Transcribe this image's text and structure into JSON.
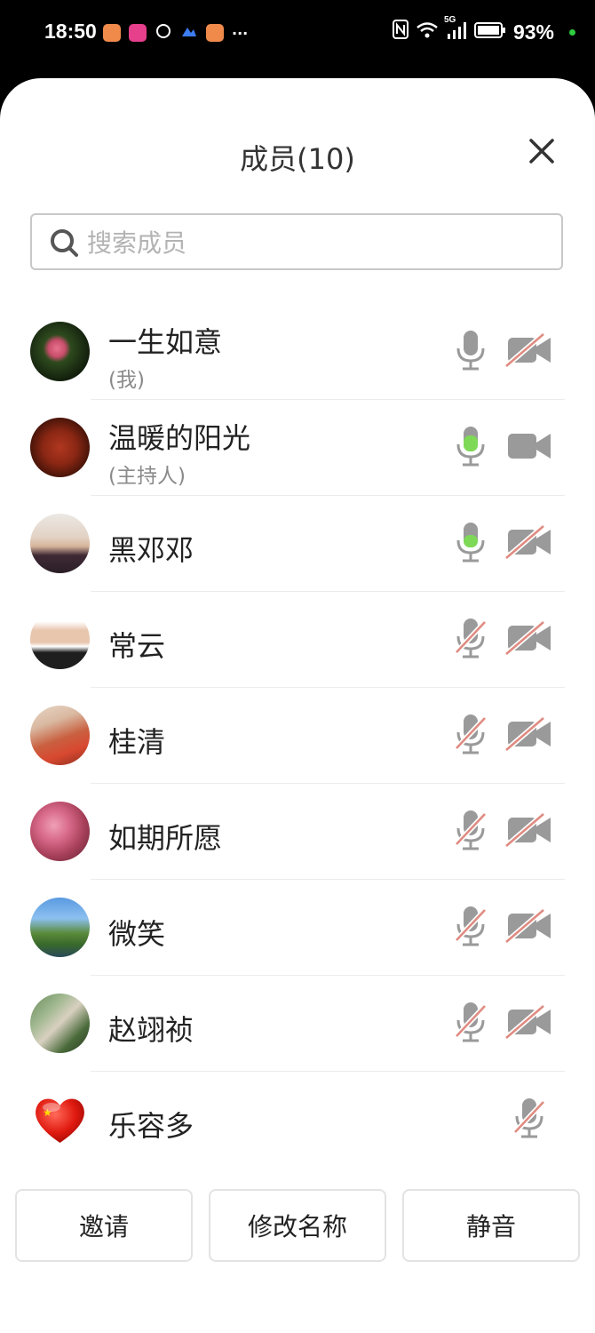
{
  "status_bar": {
    "time": "18:50",
    "more": "···",
    "network": "5G",
    "battery": "93%"
  },
  "panel": {
    "title": "成员(10)",
    "search_placeholder": "搜索成员"
  },
  "members": [
    {
      "name": "一生如意",
      "role": "(我)",
      "mic": "off",
      "camera": "off"
    },
    {
      "name": "温暖的阳光",
      "role": "(主持人)",
      "mic": "active",
      "camera": "on"
    },
    {
      "name": "黑邓邓",
      "role": "",
      "mic": "active",
      "camera": "off"
    },
    {
      "name": "常云",
      "role": "",
      "mic": "muted",
      "camera": "off"
    },
    {
      "name": "桂清",
      "role": "",
      "mic": "muted",
      "camera": "off"
    },
    {
      "name": "如期所愿",
      "role": "",
      "mic": "muted",
      "camera": "off"
    },
    {
      "name": "微笑",
      "role": "",
      "mic": "muted",
      "camera": "off"
    },
    {
      "name": "赵翊祯",
      "role": "",
      "mic": "muted",
      "camera": "off"
    },
    {
      "name": "乐容多",
      "role": "",
      "mic": "muted",
      "camera": "none"
    }
  ],
  "actions": {
    "invite": "邀请",
    "rename": "修改名称",
    "mute": "静音"
  },
  "colors": {
    "mic_active": "#7ed957",
    "icon_gray": "#9a9a9a",
    "slash_red": "#e08a80"
  }
}
